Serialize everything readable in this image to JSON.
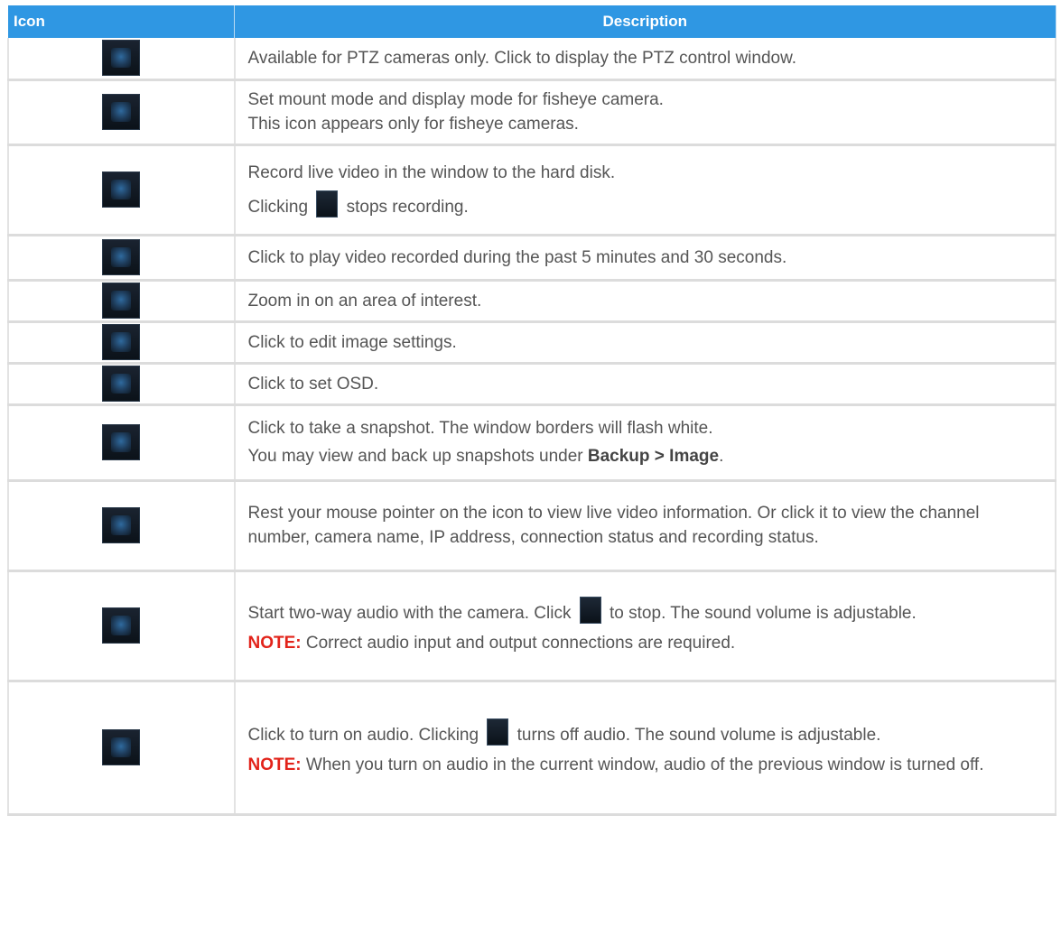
{
  "table": {
    "headers": {
      "icon": "Icon",
      "description": "Description"
    },
    "rows": [
      {
        "icon": "ptz-control-icon",
        "lines": [
          "Available for PTZ cameras only. Click to display the PTZ control window."
        ]
      },
      {
        "icon": "fisheye-mode-icon",
        "lines": [
          "Set mount mode and display mode for fisheye camera.",
          "This icon appears only for fisheye cameras."
        ]
      },
      {
        "icon": "record-icon",
        "lines": [
          "Record live video in the window to the hard disk."
        ],
        "inline_before": "Clicking",
        "inline_icon": "stop-recording-icon",
        "inline_after": "stops recording."
      },
      {
        "icon": "instant-playback-icon",
        "lines": [
          "Click to play video recorded during the past 5 minutes and 30 seconds."
        ]
      },
      {
        "icon": "digital-zoom-icon",
        "lines": [
          "Zoom in on an area of interest."
        ]
      },
      {
        "icon": "image-settings-icon",
        "lines": [
          "Click to edit image settings."
        ]
      },
      {
        "icon": "osd-icon",
        "lines": [
          "Click to set OSD."
        ]
      },
      {
        "icon": "snapshot-icon",
        "lines": [
          "Click to take a snapshot. The window borders will flash white."
        ],
        "line2_before": "You may view and back up snapshots under ",
        "line2_bold": "Backup > Image",
        "line2_after": "."
      },
      {
        "icon": "info-icon",
        "lines": [
          "Rest your mouse pointer on the icon to view live video information. Or click it to view the channel number, camera name, IP address, connection status and recording status."
        ]
      },
      {
        "icon": "two-way-audio-icon",
        "inline_before": "Start two-way audio with the camera. Click",
        "inline_icon": "stop-two-way-audio-icon",
        "inline_after": "to stop. The sound volume is adjustable.",
        "note_label": "NOTE:",
        "note_text": " Correct audio input and output connections are required."
      },
      {
        "icon": "audio-icon",
        "inline_before": "Click to turn on audio. Clicking",
        "inline_icon": "audio-off-icon",
        "inline_after": "turns off audio. The sound volume is adjustable.",
        "note_label": "NOTE:",
        "note_text": " When you turn on audio in the current window, audio of the previous window is turned off."
      }
    ]
  }
}
